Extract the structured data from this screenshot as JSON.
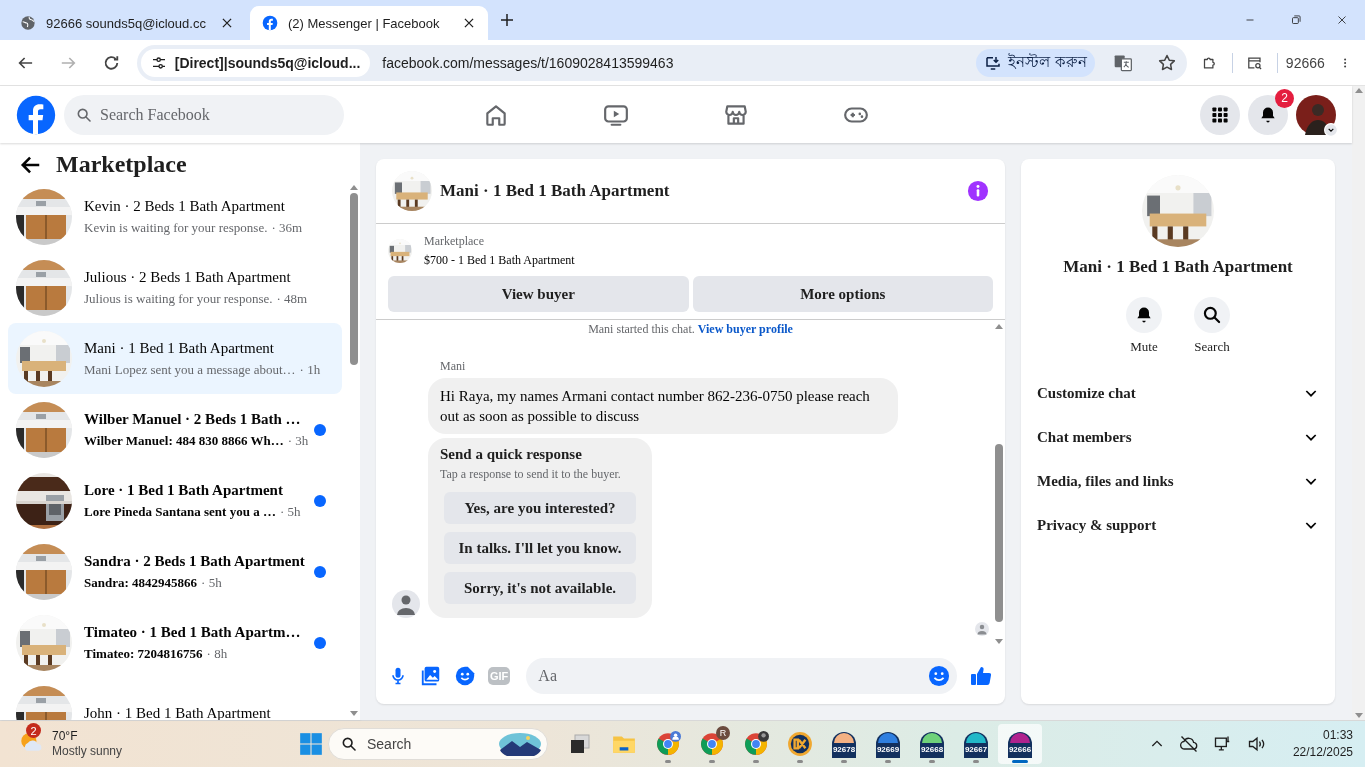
{
  "browser": {
    "tabs": [
      {
        "kind": "globe",
        "title": "92666 sounds5q@icloud.cc",
        "selected": false
      },
      {
        "kind": "facebook",
        "title": "(2) Messenger | Facebook",
        "selected": true
      }
    ],
    "site_chip": "[Direct]|sounds5q@icloud...",
    "url": "facebook.com/messages/t/1609028413599463",
    "install_label": "ইনস্টল করুন",
    "profile": "92666"
  },
  "header": {
    "search": {
      "placeholder": "Search Facebook"
    },
    "nav": [
      {
        "kind": "home"
      },
      {
        "kind": "video"
      },
      {
        "kind": "marketplace"
      },
      {
        "kind": "gaming"
      }
    ],
    "notification_count": "2"
  },
  "sidebar": {
    "title": "Marketplace",
    "conversations": [
      {
        "title": "Kevin · 2 Beds 1 Bath Apartment",
        "preview": "Kevin is waiting for your response.",
        "time": "· 36m",
        "unread": false,
        "selected": false
      },
      {
        "title": "Julious · 2 Beds 1 Bath Apartment",
        "preview": "Julious is waiting for your response.",
        "time": "· 48m",
        "unread": false,
        "selected": false
      },
      {
        "title": "Mani · 1 Bed 1 Bath Apartment",
        "preview": "Mani Lopez sent you a message about…",
        "time": "· 1h",
        "unread": false,
        "selected": true
      },
      {
        "title": "Wilber Manuel · 2 Beds 1 Bath …",
        "preview": "Wilber Manuel: 484 830 8866 Wh…",
        "time": "· 3h",
        "unread": true,
        "selected": false
      },
      {
        "title": "Lore · 1 Bed 1 Bath Apartment",
        "preview": "Lore Pineda Santana sent you a …",
        "time": "· 5h",
        "unread": true,
        "selected": false
      },
      {
        "title": "Sandra · 2 Beds 1 Bath Apartment",
        "preview": "Sandra: 4842945866",
        "time": "· 5h",
        "unread": true,
        "selected": false
      },
      {
        "title": "Timateo · 1 Bed 1 Bath Apartm…",
        "preview": "Timateo: 7204816756",
        "time": "· 8h",
        "unread": true,
        "selected": false
      },
      {
        "title": "John · 1 Bed 1 Bath Apartment",
        "selected": false
      }
    ]
  },
  "chat": {
    "title": "Mani · 1 Bed 1 Bath Apartment",
    "listing": {
      "label": "Marketplace",
      "name": "$700 - 1 Bed 1 Bath Apartment",
      "buttons": [
        "View buyer",
        "More options"
      ]
    },
    "notice": {
      "text": "Mani started this chat.",
      "link": "View buyer profile"
    },
    "sender": "Mani",
    "message": "Hi Raya, my names Armani contact number 862-236-0750 please reach out as soon as possible to discuss",
    "quick_response": {
      "title": "Send a quick response",
      "subtitle": "Tap a response to send it to the buyer.",
      "options": [
        "Yes, are you interested?",
        "In talks. I'll let you know.",
        "Sorry, it's not available."
      ]
    },
    "composer": {
      "gif_label": "GIF",
      "placeholder": "Aa"
    }
  },
  "details": {
    "title": "Mani · 1 Bed 1 Bath Apartment",
    "actions": [
      {
        "kind": "mute",
        "label": "Mute"
      },
      {
        "kind": "search",
        "label": "Search"
      }
    ],
    "sections": [
      {
        "label": "Customize chat",
        "expanded": false
      },
      {
        "label": "Chat members",
        "expanded": false
      },
      {
        "label": "Media, files and links",
        "expanded": false
      },
      {
        "label": "Privacy & support",
        "expanded": false
      }
    ]
  },
  "taskbar": {
    "weather": {
      "badge": "2",
      "temperature": "70°F",
      "condition": "Mostly sunny"
    },
    "search": {
      "placeholder": "Search"
    },
    "apps": [
      {
        "kind": "taskview",
        "running": false,
        "selected": false
      },
      {
        "kind": "folder",
        "running": false,
        "selected": false
      },
      {
        "kind": "chrome-person",
        "running": true,
        "selected": false
      },
      {
        "kind": "chrome-letter",
        "badge": "R",
        "running": true,
        "selected": false
      },
      {
        "kind": "chrome-photo",
        "running": true,
        "selected": false
      },
      {
        "kind": "ix",
        "running": true,
        "selected": false
      },
      {
        "kind": "ix-label",
        "label": "92678",
        "color": "#f4b183",
        "running": true,
        "selected": false
      },
      {
        "kind": "ix-label",
        "label": "92669",
        "color": "#2f7fe0",
        "running": true,
        "selected": false
      },
      {
        "kind": "ix-label",
        "label": "92668",
        "color": "#6fd27a",
        "running": true,
        "selected": false
      },
      {
        "kind": "ix-label",
        "label": "92667",
        "color": "#22b8c8",
        "running": true,
        "selected": false
      },
      {
        "kind": "ix-label",
        "label": "92666",
        "color": "#b0228e",
        "running": true,
        "selected": true
      }
    ],
    "time": "01:33",
    "date": "22/12/2025"
  }
}
